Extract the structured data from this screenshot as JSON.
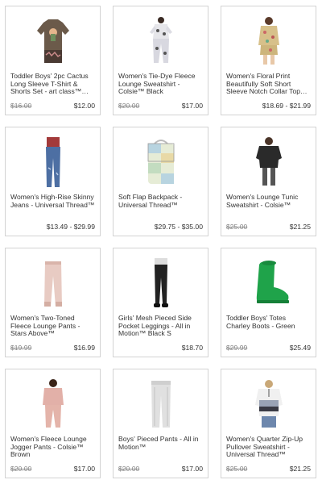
{
  "products": [
    {
      "title": "Toddler Boys' 2pc Cactus Long Sleeve T-Shirt & Shorts Set - art class™ Washed ...",
      "was": "$16.00",
      "price": "$12.00",
      "image": "cactus-tee-set-image"
    },
    {
      "title": "Women's Tie-Dye Fleece Lounge Sweatshirt - Colsie™ Black",
      "was": "$20.00",
      "price": "$17.00",
      "image": "tie-dye-lounge-set-image"
    },
    {
      "title": "Women's Floral Print Beautifully Soft Short Sleeve Notch Collar Top and Shorts P...",
      "was": "",
      "price": "$18.69 - $21.99",
      "image": "floral-pajama-image"
    },
    {
      "title": "Women's High-Rise Skinny Jeans - Universal Thread™",
      "was": "",
      "price": "$13.49 - $29.99",
      "image": "skinny-jeans-image"
    },
    {
      "title": "Soft Flap Backpack - Universal Thread™",
      "was": "",
      "price": "$29.75 - $35.00",
      "image": "patchwork-backpack-image"
    },
    {
      "title": "Women's Lounge Tunic Sweatshirt - Colsie™",
      "was": "$25.00",
      "price": "$21.25",
      "image": "tunic-sweatshirt-image"
    },
    {
      "title": "Women's Two-Toned Fleece Lounge Pants - Stars Above™",
      "was": "$19.99",
      "price": "$16.99",
      "image": "pink-lounge-pants-image"
    },
    {
      "title": "Girls' Mesh Pieced Side Pocket Leggings - All in Motion™ Black S",
      "was": "",
      "price": "$18.70",
      "image": "black-leggings-image"
    },
    {
      "title": "Toddler Boys' Totes Charley Boots - Green",
      "was": "$29.99",
      "price": "$25.49",
      "image": "green-rain-boot-image"
    },
    {
      "title": "Women's Fleece Lounge Jogger Pants - Colsie™ Brown",
      "was": "$20.00",
      "price": "$17.00",
      "image": "fleece-jogger-image"
    },
    {
      "title": "Boys' Pieced Pants - All in Motion™",
      "was": "$20.00",
      "price": "$17.00",
      "image": "grey-pants-image"
    },
    {
      "title": "Women's Quarter Zip-Up Pullover Sweatshirt - Universal Thread™",
      "was": "$25.00",
      "price": "$21.25",
      "image": "quarter-zip-pullover-image"
    }
  ],
  "colors": {
    "border": "#d3d3d3",
    "text": "#333333",
    "strike": "#888888",
    "cactus_shirt": "#6b5a4a",
    "boot_green": "#1fa34a"
  }
}
